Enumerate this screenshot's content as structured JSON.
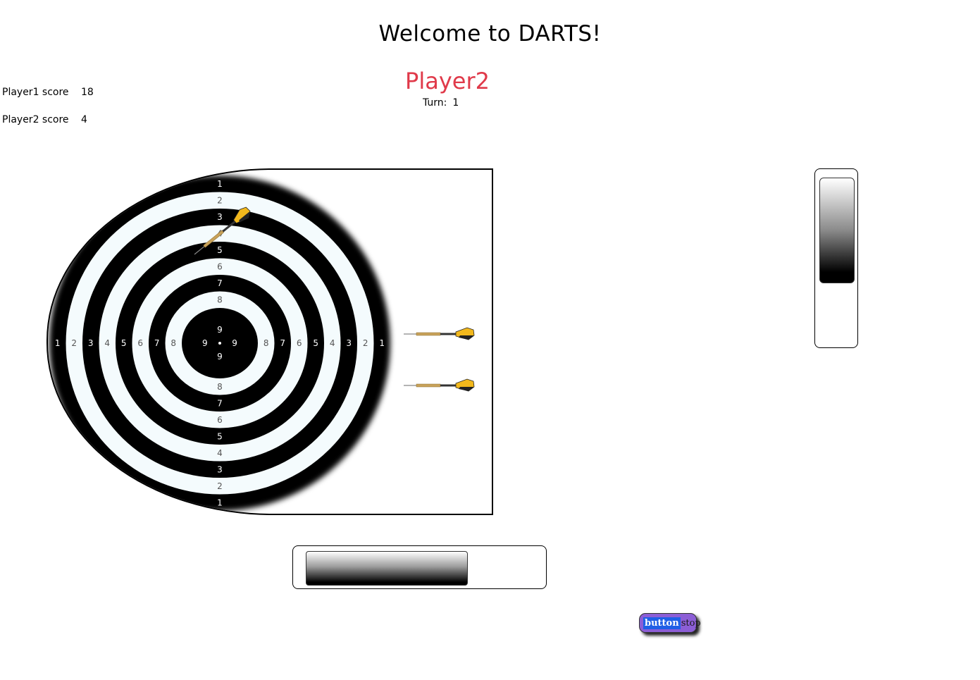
{
  "page": {
    "title": "Welcome to DARTS!"
  },
  "game": {
    "current_player": "Player2",
    "turn_label": "Turn:",
    "turn_value": "1",
    "player_name_color": "#e03a4a"
  },
  "scores": [
    {
      "label": "Player1 score",
      "value": "18"
    },
    {
      "label": "Player2 score",
      "value": "4"
    }
  ],
  "dartboard": {
    "ring_values": [
      1,
      2,
      3,
      4,
      5,
      6,
      7,
      8,
      9
    ],
    "dart_icons": [
      "thrown-dart-icon",
      "waiting-dart-icon",
      "waiting-dart-icon"
    ],
    "dart_flight_color": "#f2b81c"
  },
  "power_meters": {
    "vertical_level": 0.59,
    "horizontal_level": 0.64
  },
  "stop_button": {
    "main_label": "button",
    "sub_label": "stop"
  }
}
